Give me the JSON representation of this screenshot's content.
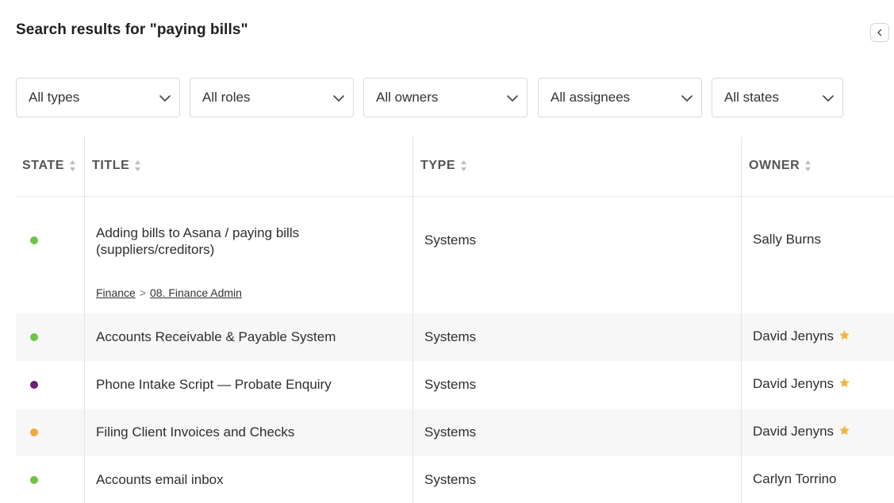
{
  "page": {
    "title": "Search results for \"paying bills\""
  },
  "filters": {
    "types": "All types",
    "roles": "All roles",
    "owners": "All owners",
    "assignees": "All assignees",
    "states": "All states"
  },
  "table": {
    "headers": {
      "state": "STATE",
      "title": "TITLE",
      "type": "TYPE",
      "owner": "OWNER"
    },
    "rows": [
      {
        "state_color": "#6cc644",
        "title": "Adding bills to Asana / paying bills (suppliers/creditors)",
        "breadcrumb": [
          "Finance",
          "08. Finance Admin"
        ],
        "breadcrumb_sep": ">",
        "type": "Systems",
        "owner": "Sally Burns",
        "starred": false
      },
      {
        "state_color": "#6cc644",
        "title": "Accounts Receivable & Payable System",
        "type": "Systems",
        "owner": "David Jenyns",
        "starred": true
      },
      {
        "state_color": "#6b1f72",
        "title": "Phone Intake Script — Probate Enquiry",
        "type": "Systems",
        "owner": "David Jenyns",
        "starred": true
      },
      {
        "state_color": "#f0a93b",
        "title": "Filing Client Invoices and Checks",
        "type": "Systems",
        "owner": "David Jenyns",
        "starred": true
      },
      {
        "state_color": "#6cc644",
        "title": "Accounts email inbox",
        "type": "Systems",
        "owner": "Carlyn Torrino",
        "starred": false
      }
    ]
  },
  "colors": {
    "star": "#f0b440",
    "status_green": "#6cc644",
    "status_purple": "#6b1f72",
    "status_orange": "#f0a93b"
  },
  "icons": {
    "collapse": "chevron-left-icon",
    "dropdown": "chevron-down-icon",
    "sort": "sort-icon",
    "star": "star-icon"
  }
}
